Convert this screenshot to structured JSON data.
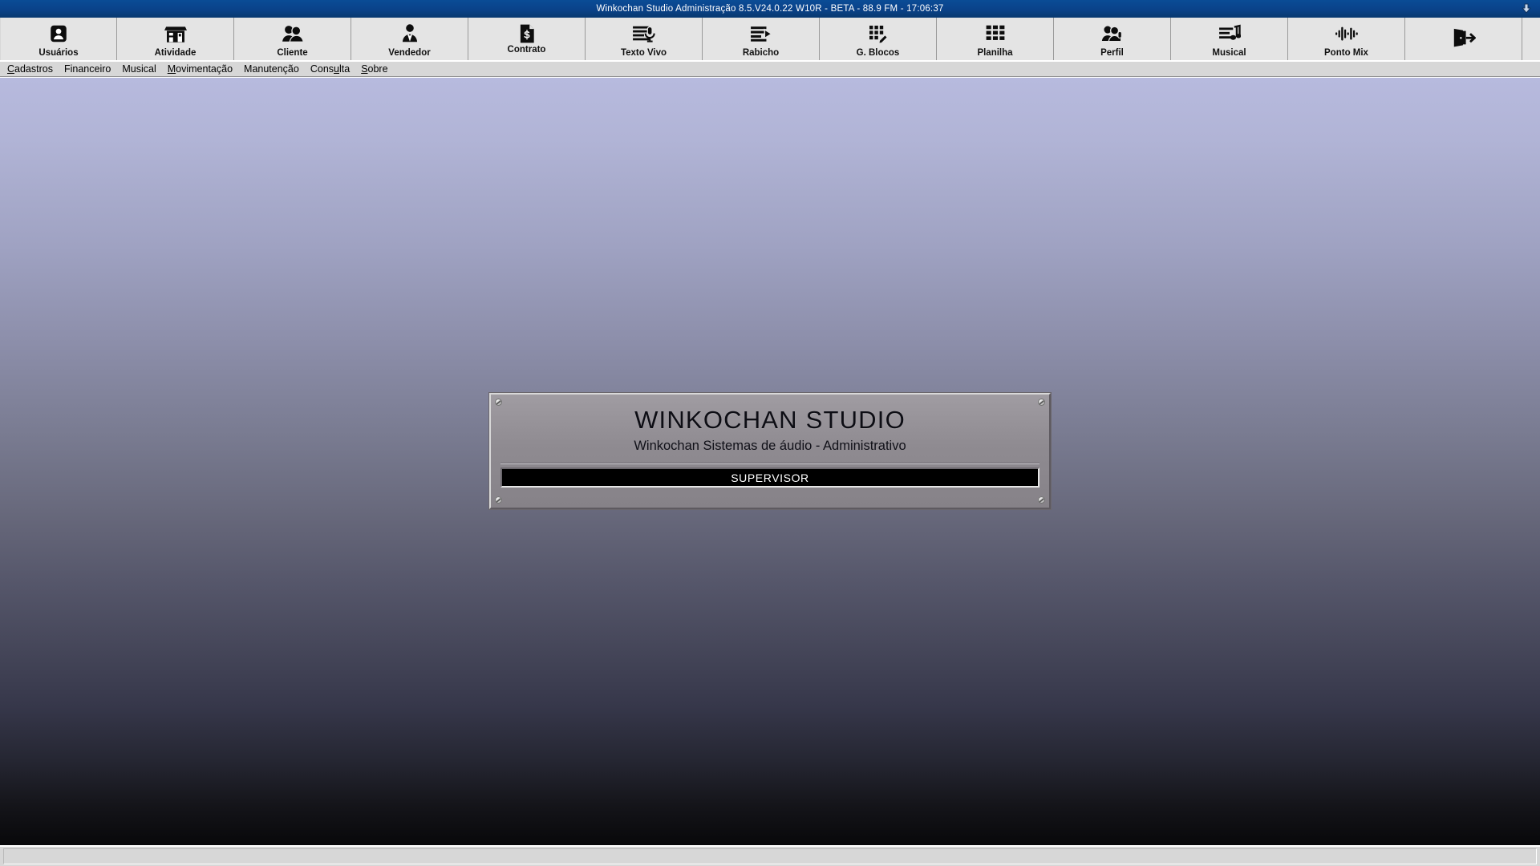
{
  "window": {
    "title": "Winkochan Studio Administração 8.5.V24.0.22 W10R - BETA - 88.9 FM  -  17:06:37",
    "minimize_icon": "down-arrow-icon"
  },
  "colors": {
    "titlebar": "#0a4289",
    "toolbar": "#e4e4e4",
    "menubar": "#d7d7d7",
    "panel": "#8f8b91",
    "field_background": "#000000",
    "field_text": "#ffffff",
    "desktop_top": "#b7bade",
    "desktop_bottom": "#08080a"
  },
  "toolbar": {
    "buttons": [
      {
        "label": "Usuários",
        "icon": "user-badge-icon"
      },
      {
        "label": "Atividade",
        "icon": "storefront-icon"
      },
      {
        "label": "Cliente",
        "icon": "two-people-icon"
      },
      {
        "label": "Vendedor",
        "icon": "person-tie-icon"
      },
      {
        "label": "Contrato",
        "icon": "document-money-icon"
      },
      {
        "label": "Texto Vivo",
        "icon": "lines-microphone-icon"
      },
      {
        "label": "Rabicho",
        "icon": "lines-play-icon"
      },
      {
        "label": "G. Blocos",
        "icon": "blocks-pencil-icon"
      },
      {
        "label": "Planilha",
        "icon": "grid-icon"
      },
      {
        "label": "Perfil",
        "icon": "people-mic-icon"
      },
      {
        "label": "Musical",
        "icon": "lines-music-note-icon"
      },
      {
        "label": "Ponto Mix",
        "icon": "waveform-icon"
      },
      {
        "label": "",
        "icon": "exit-door-icon"
      }
    ]
  },
  "menubar": {
    "items": [
      {
        "pre": "",
        "accel": "C",
        "post": "adastros"
      },
      {
        "pre": "Financeiro",
        "accel": "",
        "post": ""
      },
      {
        "pre": "Musical",
        "accel": "",
        "post": ""
      },
      {
        "pre": "",
        "accel": "M",
        "post": "ovimentação"
      },
      {
        "pre": "Manutenção",
        "accel": "",
        "post": ""
      },
      {
        "pre": "Cons",
        "accel": "u",
        "post": "lta"
      },
      {
        "pre": "",
        "accel": "S",
        "post": "obre"
      }
    ]
  },
  "panel": {
    "title": "WINKOCHAN STUDIO",
    "subtitle": "Winkochan Sistemas de áudio - Administrativo",
    "field_value": "SUPERVISOR"
  },
  "statusbar": {
    "text": ""
  }
}
